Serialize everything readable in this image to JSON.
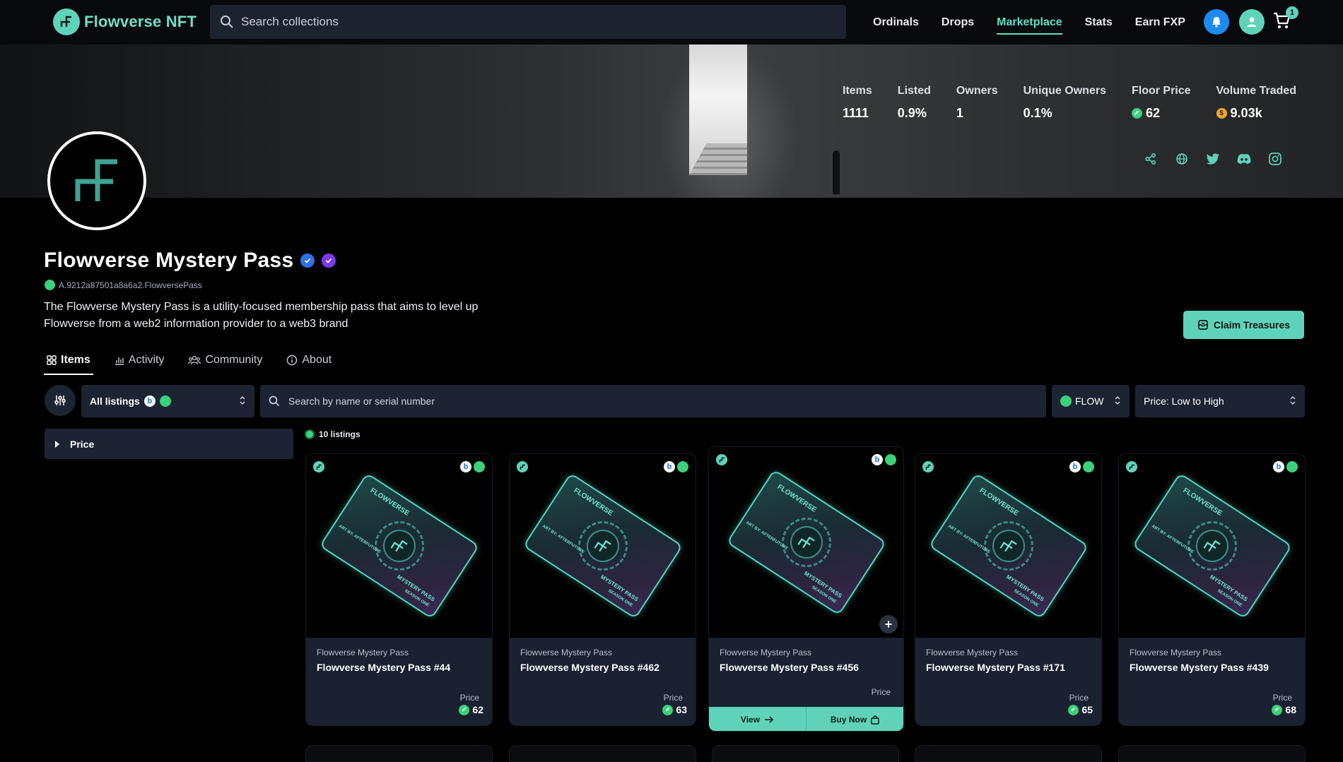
{
  "app": {
    "logo_text": "Flowverse NFT",
    "search_placeholder": "Search collections",
    "nav": [
      "Ordinals",
      "Drops",
      "Marketplace",
      "Stats",
      "Earn FXP"
    ],
    "active_nav": "Marketplace",
    "cart_count": "1",
    "colors": {
      "accent": "#5fd3b9",
      "bell": "#1d8bf1",
      "flow_green": "#3ad17a",
      "panel": "#1c2433"
    }
  },
  "banner": {
    "stats": [
      {
        "label": "Items",
        "value": "1111",
        "icon": ""
      },
      {
        "label": "Listed",
        "value": "0.9%",
        "icon": ""
      },
      {
        "label": "Owners",
        "value": "1",
        "icon": ""
      },
      {
        "label": "Unique Owners",
        "value": "0.1%",
        "icon": ""
      },
      {
        "label": "Floor Price",
        "value": "62",
        "icon": "flow-coin"
      },
      {
        "label": "Volume Traded",
        "value": "9.03k",
        "icon": "usd-coin"
      }
    ],
    "socials": [
      "share-icon",
      "globe-icon",
      "twitter-icon",
      "discord-icon",
      "instagram-icon"
    ]
  },
  "collection": {
    "title": "Flowverse Mystery Pass",
    "contract": "A.9212a87501a8a6a2.FlowversePass",
    "description_line1": "The Flowverse Mystery Pass is a utility-focused membership pass that aims to level up",
    "description_line2": "Flowverse from a web2 information provider to a web3 brand",
    "claim_button": "Claim Treasures"
  },
  "tabs": [
    {
      "label": "Items",
      "icon": "grid-icon"
    },
    {
      "label": "Activity",
      "icon": "chart-icon"
    },
    {
      "label": "Community",
      "icon": "people-icon"
    },
    {
      "label": "About",
      "icon": "info-icon"
    }
  ],
  "filters": {
    "listings_select": "All listings",
    "search_placeholder": "Search by name or serial number",
    "currency": "FLOW",
    "sort": "Price: Low to High",
    "price_panel": "Price",
    "listings_count": "10 listings"
  },
  "cards": [
    {
      "collection": "Flowverse Mystery Pass",
      "name": "Flowverse Mystery Pass #44",
      "price_label": "Price",
      "price": "62"
    },
    {
      "collection": "Flowverse Mystery Pass",
      "name": "Flowverse Mystery Pass #462",
      "price_label": "Price",
      "price": "63"
    },
    {
      "collection": "Flowverse Mystery Pass",
      "name": "Flowverse Mystery Pass #456",
      "price_label": "Price",
      "price": "",
      "view_label": "View",
      "buy_label": "Buy Now"
    },
    {
      "collection": "Flowverse Mystery Pass",
      "name": "Flowverse Mystery Pass #171",
      "price_label": "Price",
      "price": "65"
    },
    {
      "collection": "Flowverse Mystery Pass",
      "name": "Flowverse Mystery Pass #439",
      "price_label": "Price",
      "price": "68"
    }
  ],
  "pass_art": {
    "brand": "FLOWVERSE",
    "art_by": "ART BY: AFTERFUTURE",
    "title": "MYSTERY PASS",
    "season": "SEASON ONE"
  }
}
